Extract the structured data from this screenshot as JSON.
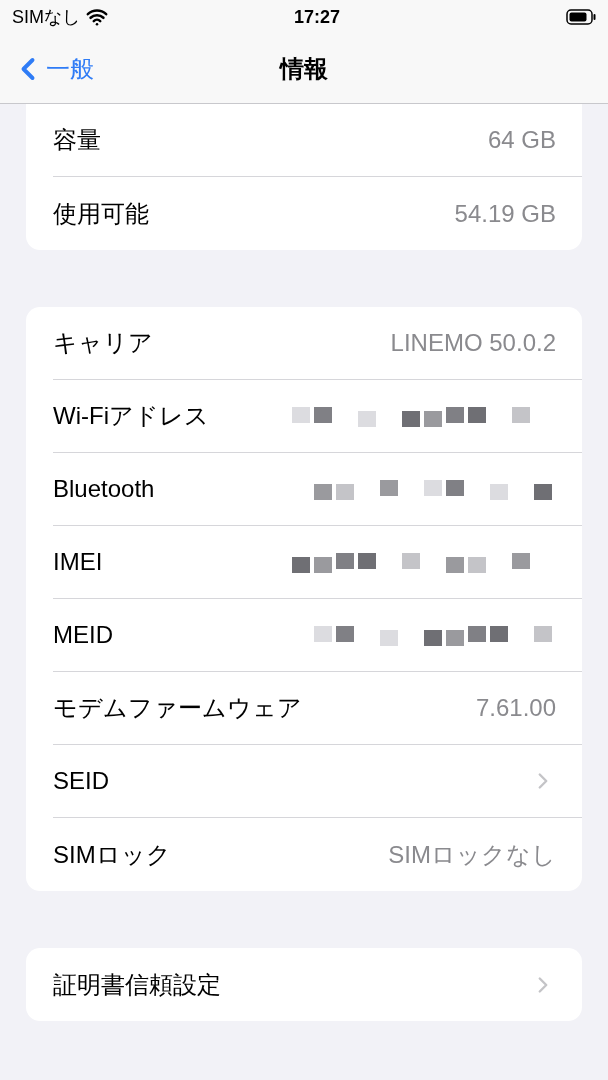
{
  "status_bar": {
    "carrier": "SIMなし",
    "time": "17:27"
  },
  "nav": {
    "back": "一般",
    "title": "情報"
  },
  "groups": [
    {
      "rows": [
        {
          "kind": "value",
          "label": "容量",
          "value": "64 GB"
        },
        {
          "kind": "value",
          "label": "使用可能",
          "value": "54.19 GB"
        }
      ]
    },
    {
      "rows": [
        {
          "kind": "value",
          "label": "キャリア",
          "value": "LINEMO 50.0.2"
        },
        {
          "kind": "redacted",
          "label": "Wi-Fiアドレス"
        },
        {
          "kind": "redacted",
          "label": "Bluetooth"
        },
        {
          "kind": "redacted",
          "label": "IMEI"
        },
        {
          "kind": "redacted",
          "label": "MEID"
        },
        {
          "kind": "value",
          "label": "モデムファームウェア",
          "value": "7.61.00"
        },
        {
          "kind": "chevron",
          "label": "SEID"
        },
        {
          "kind": "value",
          "label": "SIMロック",
          "value": "SIMロックなし"
        }
      ]
    },
    {
      "rows": [
        {
          "kind": "chevron",
          "label": "証明書信頼設定"
        }
      ]
    }
  ]
}
